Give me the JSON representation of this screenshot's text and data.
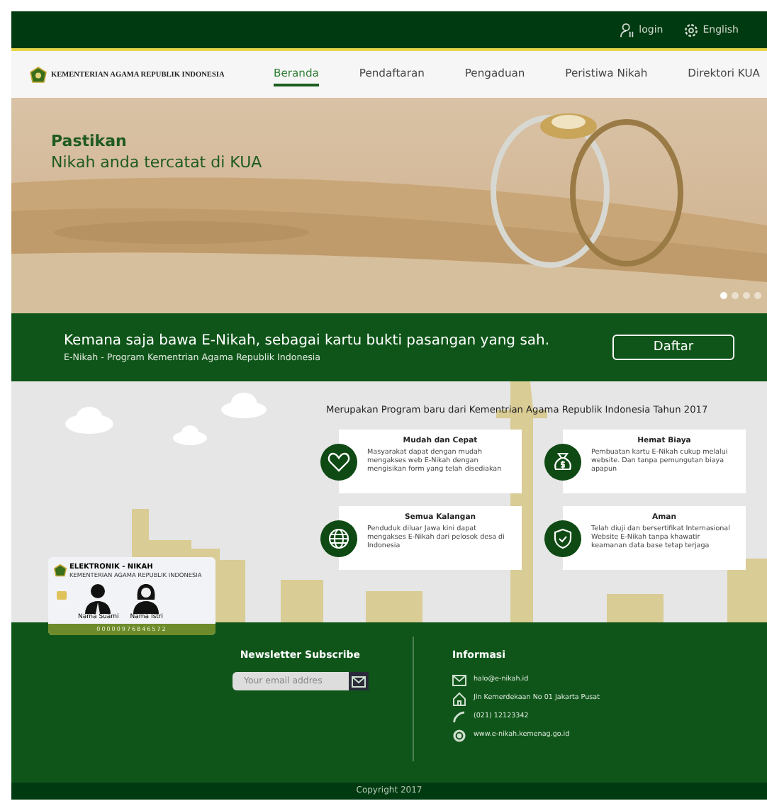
{
  "top_bar": {
    "links": [
      {
        "kind": "user",
        "label": "login"
      },
      {
        "kind": "gear",
        "label": "English"
      }
    ]
  },
  "nav": {
    "brand": "KEMENTERIAN AGAMA REPUBLIK INDONESIA",
    "items": [
      {
        "label": "Beranda",
        "selected": true
      },
      {
        "label": "Pendaftaran",
        "selected": false
      },
      {
        "label": "Pengaduan",
        "selected": false
      },
      {
        "label": "Peristiwa Nikah",
        "selected": false
      },
      {
        "label": "Direktori KUA",
        "selected": false
      }
    ]
  },
  "hero": {
    "kind": "picture",
    "title": "Pastikan",
    "subtitle": "Nikah anda tercatat di KUA",
    "dots": [
      {
        "selected": true
      },
      {
        "selected": false
      },
      {
        "selected": false
      },
      {
        "selected": false
      }
    ]
  },
  "banner": {
    "headline": "Kemana saja bawa E-Nikah, sebagai kartu bukti pasangan yang sah.",
    "subline": "E-Nikah - Program Kementrian Agama Republik Indonesia",
    "button": "Daftar"
  },
  "features": {
    "heading": "Merupakan Program baru dari Kementrian Agama Republik Indonesia Tahun 2017",
    "items": [
      {
        "kind": "heart",
        "title": "Mudah dan Cepat",
        "text": "Masyarakat dapat dengan mudah mengakses web E-Nikah dengan mengisikan form yang telah disediakan"
      },
      {
        "kind": "money",
        "title": "Hemat Biaya",
        "text": "Pembuatan kartu E-Nikah cukup melalui website. Dan tanpa pemungutan biaya apapun"
      },
      {
        "kind": "globe",
        "title": "Semua Kalangan",
        "text": "Penduduk diluar Jawa kini dapat mengakses E-Nikah dari pelosok desa di Indonesia"
      },
      {
        "kind": "shield",
        "title": "Aman",
        "text": "Telah diuji dan bersertifikat Internasional Website E-Nikah tanpa khawatir keamanan data base tetap terjaga"
      }
    ]
  },
  "card": {
    "title": "ELEKTRONIK - NIKAH",
    "subtitle": "KEMENTERIAN AGAMA REPUBLIK INDONESIA",
    "husband": "Nama Suami",
    "wife": "Nama Istri",
    "number": "00000976846572"
  },
  "newsletter": {
    "heading": "Newsletter Subscribe",
    "placeholder": "Your email addres"
  },
  "info": {
    "heading": "Informasi",
    "items": [
      {
        "kind": "mail",
        "text": "halo@e-nikah.id"
      },
      {
        "kind": "home",
        "text": "Jln Kemerdekaan No 01 Jakarta Pusat"
      },
      {
        "kind": "phone",
        "text": "(021) 12123342"
      },
      {
        "kind": "web",
        "text": "www.e-nikah.kemenag.go.id"
      }
    ]
  },
  "copyright": "Copyright 2017"
}
